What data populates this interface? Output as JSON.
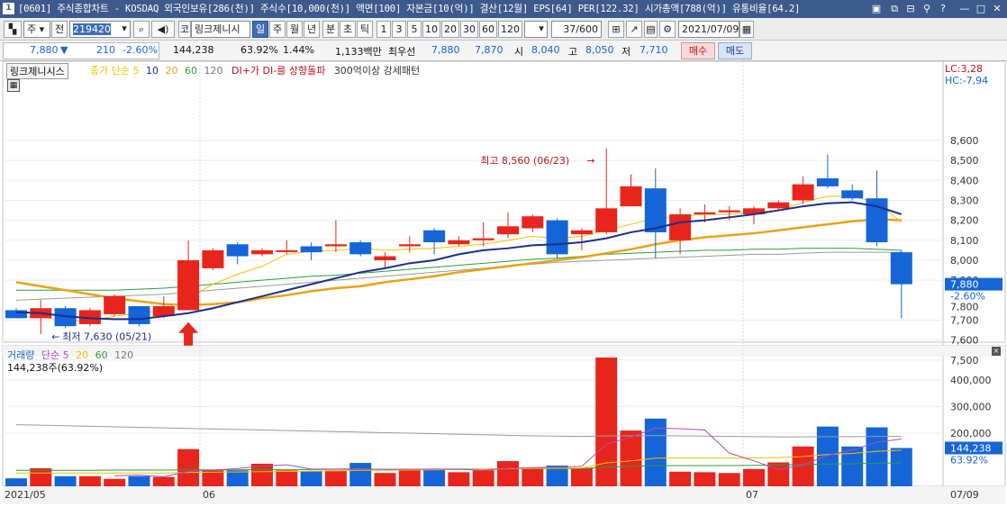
{
  "window": {
    "title": "[0601] 주식종합차트 - KOSDAQ 외국인보유[286(천)] 주식수[10,000(천)] 액면[100] 자본금[10(억)] 결산[12월] EPS[64] PER[122.32] 시가총액[788(억)] 유통비율[64.2]",
    "number_badge": "1"
  },
  "toolbar": {
    "mode_label": "주",
    "period_label": "전",
    "code": "219420",
    "stock_name": "링크제니시",
    "market_prefix": "코",
    "period_tabs": [
      "일",
      "주",
      "월",
      "년",
      "분",
      "초",
      "틱"
    ],
    "selected_tab": "일",
    "minute_buttons": [
      "1",
      "3",
      "5",
      "10",
      "20",
      "30",
      "60",
      "120"
    ],
    "count": "37",
    "count_max": "/600",
    "date": "2021/07/09"
  },
  "quote": {
    "price": "7,880",
    "change_arrow": "▼",
    "change": "210",
    "change_pct": "-2.60%",
    "volume": "144,238",
    "volume_ratio": "63.92%",
    "turnover": "1.44%",
    "amount": "1,133백만",
    "best_label": "최우선",
    "best_ask": "7,880",
    "best_bid": "7,870",
    "open_label": "시",
    "open": "8,040",
    "high_label": "고",
    "high": "8,050",
    "low_label": "저",
    "low": "7,710",
    "buy_label": "매수",
    "sell_label": "매도"
  },
  "colors": {
    "up": "#e8251c",
    "down": "#1565d8",
    "ma5": "#f0c200",
    "ma10": "#1a2f8c",
    "ma20": "#e8a317",
    "ma60": "#2e9e3e",
    "ma120": "#9a9a9a",
    "vol_ma5": "#b04ab8"
  },
  "price_panel": {
    "stock_label": "링크제니시스",
    "legend": [
      {
        "text": "종가 단순",
        "color": "#f0c200"
      },
      {
        "text": "5",
        "color": "#f0c200"
      },
      {
        "text": "10",
        "color": "#1a2f8c"
      },
      {
        "text": "20",
        "color": "#e8a317"
      },
      {
        "text": "60",
        "color": "#2e9e3e"
      },
      {
        "text": "120",
        "color": "#777777"
      },
      {
        "text": "DI+가 DI-를 상향돌파",
        "color": "#c0101a"
      },
      {
        "text": "300억이상 강세패턴",
        "color": "#333333"
      }
    ],
    "lc": "LC:3,28",
    "hc": "HC:-7,94",
    "high_annot": "최고 8,560 (06/23)",
    "low_annot": "최저 7,630 (05/21)",
    "last_price_tag": "7,880",
    "last_pct_tag": "-2.60%",
    "hidden_tick": "7,800"
  },
  "volume_panel": {
    "legend": [
      {
        "text": "거래량",
        "color": "#1565d8"
      },
      {
        "text": "단순",
        "color": "#b04ab8"
      },
      {
        "text": "5",
        "color": "#b04ab8"
      },
      {
        "text": "20",
        "color": "#f0c200"
      },
      {
        "text": "60",
        "color": "#2e9e3e"
      },
      {
        "text": "120",
        "color": "#777777"
      }
    ],
    "info": "144,238주(63.92%)",
    "last_tag": "144,238",
    "last_pct_tag": "63.92%"
  },
  "x_labels": {
    "start": "2021/05",
    "m06": "06",
    "m07": "07",
    "end": "07/09"
  },
  "chart_data": {
    "type": "candlestick",
    "price_axis": {
      "ticks": [
        7500,
        7600,
        7700,
        7900,
        8000,
        8100,
        8200,
        8300,
        8400,
        8500,
        8600
      ],
      "tick_labels": [
        "7,500",
        "7,600",
        "7,700",
        "7,900",
        "8,000",
        "8,100",
        "8,200",
        "8,300",
        "8,400",
        "8,500",
        "8,600"
      ]
    },
    "volume_axis": {
      "ticks": [
        200000,
        300000,
        400000
      ],
      "tick_labels": [
        "200,000",
        "300,000",
        "400,000"
      ]
    },
    "candles": [
      {
        "o": 7750,
        "c": 7710,
        "h": 7760,
        "l": 7710
      },
      {
        "o": 7710,
        "c": 7760,
        "h": 7800,
        "l": 7630
      },
      {
        "o": 7760,
        "c": 7670,
        "h": 7770,
        "l": 7660
      },
      {
        "o": 7680,
        "c": 7750,
        "h": 7760,
        "l": 7670
      },
      {
        "o": 7730,
        "c": 7820,
        "h": 7830,
        "l": 7720
      },
      {
        "o": 7770,
        "c": 7680,
        "h": 7770,
        "l": 7670
      },
      {
        "o": 7720,
        "c": 7770,
        "h": 7820,
        "l": 7710
      },
      {
        "o": 7750,
        "c": 8000,
        "h": 8100,
        "l": 7750
      },
      {
        "o": 7960,
        "c": 8050,
        "h": 8060,
        "l": 7950
      },
      {
        "o": 8080,
        "c": 8020,
        "h": 8090,
        "l": 7980
      },
      {
        "o": 8030,
        "c": 8050,
        "h": 8060,
        "l": 8020
      },
      {
        "o": 8050,
        "c": 8050,
        "h": 8100,
        "l": 8030
      },
      {
        "o": 8070,
        "c": 8040,
        "h": 8090,
        "l": 8000
      },
      {
        "o": 8070,
        "c": 8080,
        "h": 8200,
        "l": 8040
      },
      {
        "o": 8090,
        "c": 8030,
        "h": 8100,
        "l": 8020
      },
      {
        "o": 8000,
        "c": 8020,
        "h": 8040,
        "l": 7960
      },
      {
        "o": 8070,
        "c": 8080,
        "h": 8120,
        "l": 8040
      },
      {
        "o": 8150,
        "c": 8090,
        "h": 8160,
        "l": 8030
      },
      {
        "o": 8080,
        "c": 8100,
        "h": 8120,
        "l": 8070
      },
      {
        "o": 8100,
        "c": 8110,
        "h": 8190,
        "l": 8070
      },
      {
        "o": 8130,
        "c": 8170,
        "h": 8240,
        "l": 8110
      },
      {
        "o": 8160,
        "c": 8220,
        "h": 8230,
        "l": 8140
      },
      {
        "o": 8200,
        "c": 8030,
        "h": 8210,
        "l": 8010
      },
      {
        "o": 8130,
        "c": 8150,
        "h": 8160,
        "l": 8050
      },
      {
        "o": 8140,
        "c": 8260,
        "h": 8560,
        "l": 8130
      },
      {
        "o": 8270,
        "c": 8370,
        "h": 8430,
        "l": 8270
      },
      {
        "o": 8360,
        "c": 8140,
        "h": 8460,
        "l": 8010
      },
      {
        "o": 8100,
        "c": 8230,
        "h": 8260,
        "l": 8030
      },
      {
        "o": 8230,
        "c": 8240,
        "h": 8280,
        "l": 8190
      },
      {
        "o": 8240,
        "c": 8250,
        "h": 8270,
        "l": 8200
      },
      {
        "o": 8230,
        "c": 8260,
        "h": 8270,
        "l": 8180
      },
      {
        "o": 8260,
        "c": 8290,
        "h": 8300,
        "l": 8250
      },
      {
        "o": 8300,
        "c": 8380,
        "h": 8420,
        "l": 8280
      },
      {
        "o": 8410,
        "c": 8370,
        "h": 8530,
        "l": 8360
      },
      {
        "o": 8350,
        "c": 8310,
        "h": 8380,
        "l": 8300
      },
      {
        "o": 8310,
        "c": 8090,
        "h": 8450,
        "l": 8070
      },
      {
        "o": 8040,
        "c": 7880,
        "h": 8050,
        "l": 7710
      }
    ],
    "volume": [
      30000,
      68000,
      38000,
      38000,
      28000,
      38000,
      35000,
      140000,
      60000,
      60000,
      85000,
      60000,
      58000,
      60000,
      88000,
      50000,
      65000,
      62000,
      53000,
      60000,
      95000,
      70000,
      78000,
      68000,
      485000,
      210000,
      255000,
      55000,
      53000,
      50000,
      65000,
      90000,
      150000,
      225000,
      150000,
      222000,
      144238
    ],
    "ma5": [
      7720,
      7715,
      7700,
      7695,
      7720,
      7735,
      7750,
      7810,
      7880,
      7930,
      7970,
      8030,
      8045,
      8050,
      8060,
      8050,
      8055,
      8060,
      8070,
      8080,
      8100,
      8120,
      8110,
      8120,
      8150,
      8180,
      8210,
      8220,
      8230,
      8230,
      8240,
      8250,
      8290,
      8320,
      8320,
      8290,
      8190
    ],
    "ma10": [
      7740,
      7735,
      7720,
      7710,
      7705,
      7705,
      7720,
      7735,
      7760,
      7790,
      7820,
      7850,
      7880,
      7910,
      7940,
      7960,
      7985,
      8000,
      8030,
      8050,
      8060,
      8075,
      8080,
      8090,
      8110,
      8140,
      8160,
      8190,
      8200,
      8215,
      8230,
      8250,
      8270,
      8285,
      8290,
      8270,
      8230
    ],
    "ma20": [
      7890,
      7870,
      7850,
      7830,
      7810,
      7795,
      7780,
      7775,
      7780,
      7790,
      7810,
      7825,
      7845,
      7860,
      7870,
      7890,
      7905,
      7920,
      7940,
      7955,
      7970,
      7985,
      8000,
      8015,
      8035,
      8055,
      8080,
      8100,
      8115,
      8125,
      8135,
      8150,
      8165,
      8180,
      8195,
      8205,
      8200
    ],
    "ma60": [
      7850,
      7850,
      7850,
      7850,
      7850,
      7855,
      7860,
      7870,
      7880,
      7890,
      7900,
      7910,
      7920,
      7925,
      7935,
      7945,
      7955,
      7965,
      7975,
      7985,
      7995,
      8005,
      8010,
      8020,
      8030,
      8035,
      8040,
      8045,
      8050,
      8050,
      8055,
      8055,
      8060,
      8060,
      8060,
      8055,
      8050
    ],
    "ma120": [
      7800,
      7805,
      7810,
      7815,
      7820,
      7825,
      7830,
      7840,
      7850,
      7860,
      7870,
      7880,
      7890,
      7900,
      7910,
      7920,
      7930,
      7940,
      7950,
      7960,
      7970,
      7980,
      7990,
      7995,
      8000,
      8005,
      8010,
      8015,
      8020,
      8025,
      8030,
      8030,
      8035,
      8040,
      8040,
      8040,
      8040
    ],
    "vol_ma5": [
      null,
      null,
      null,
      null,
      40000,
      42000,
      36000,
      56000,
      60000,
      67000,
      76000,
      81000,
      65000,
      65000,
      66000,
      63000,
      64000,
      65000,
      64000,
      60000,
      67000,
      70000,
      73000,
      75000,
      159000,
      185000,
      219000,
      217000,
      212000,
      125000,
      96000,
      63000,
      80000,
      117000,
      136000,
      166000,
      178000
    ],
    "vol_ma20": [
      50000,
      50000,
      50000,
      50000,
      50000,
      50000,
      50000,
      52000,
      53000,
      54000,
      55000,
      56000,
      57000,
      58000,
      60000,
      60000,
      61000,
      62000,
      63000,
      64000,
      66000,
      67000,
      68000,
      69000,
      88000,
      96000,
      106000,
      107000,
      107000,
      106000,
      107000,
      108000,
      112000,
      120000,
      124000,
      132000,
      136000
    ],
    "vol_ma60": [
      60000,
      60000,
      60000,
      60000,
      61000,
      61000,
      61000,
      62000,
      62000,
      62000,
      63000,
      63000,
      63000,
      64000,
      64000,
      64000,
      64000,
      65000,
      65000,
      65000,
      66000,
      66000,
      66000,
      67000,
      72000,
      75000,
      78000,
      78000,
      78000,
      78000,
      79000,
      80000,
      82000,
      84000,
      85000,
      87000,
      88000
    ],
    "vol_ma120": [
      232000,
      230000,
      228000,
      226000,
      224000,
      222000,
      220000,
      218000,
      216000,
      214000,
      212000,
      210000,
      208000,
      206000,
      204000,
      202000,
      200000,
      198000,
      196000,
      194000,
      192000,
      190000,
      189000,
      188000,
      190000,
      190000,
      191000,
      190000,
      189000,
      188000,
      187000,
      186000,
      186000,
      187000,
      187000,
      188000,
      188000
    ]
  }
}
